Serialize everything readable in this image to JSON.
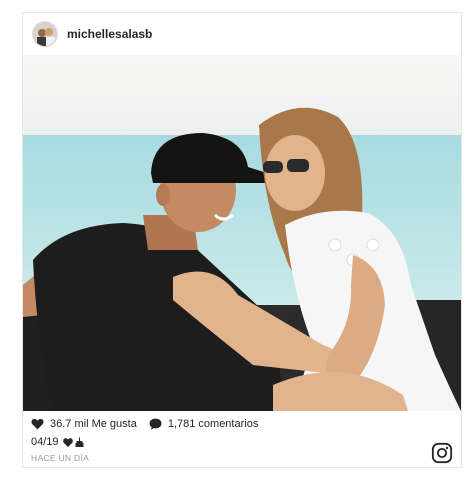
{
  "post": {
    "username": "michellesalasb",
    "likes": "36.7 mil Me gusta",
    "comments": "1,781 comentarios",
    "caption": "04/19",
    "time_ago": "HACE UN DÍA"
  },
  "icons": {
    "like": "heart-icon",
    "comment": "speech-bubble-icon",
    "caption_emoji": "heart-cake-emoji",
    "brand": "instagram-icon"
  },
  "colors": {
    "text": "#262626",
    "muted": "#999999",
    "border": "#e6e6e6"
  }
}
